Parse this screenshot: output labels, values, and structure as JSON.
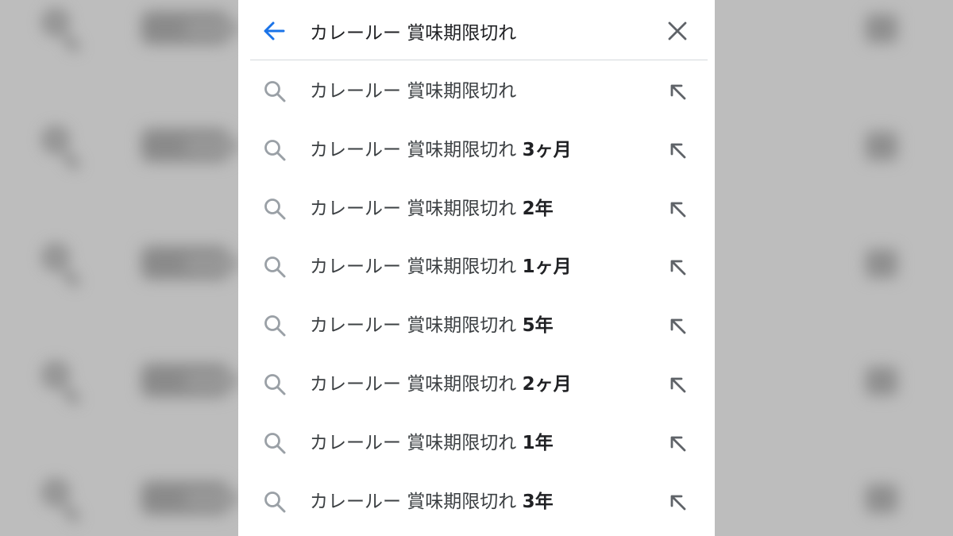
{
  "search": {
    "query": "カレールー 賞味期限切れ",
    "back_icon": "arrow-left-icon",
    "clear_icon": "close-icon"
  },
  "colors": {
    "accent": "#1a73e8",
    "icon_gray": "#9aa0a6",
    "text": "#202124"
  },
  "suggestions": [
    {
      "prefix": "カレールー 賞味期限切れ",
      "suffix": ""
    },
    {
      "prefix": "カレールー 賞味期限切れ",
      "suffix": "3ヶ月"
    },
    {
      "prefix": "カレールー 賞味期限切れ",
      "suffix": "2年"
    },
    {
      "prefix": "カレールー 賞味期限切れ",
      "suffix": "1ヶ月"
    },
    {
      "prefix": "カレールー 賞味期限切れ",
      "suffix": "5年"
    },
    {
      "prefix": "カレールー 賞味期限切れ",
      "suffix": "2ヶ月"
    },
    {
      "prefix": "カレールー 賞味期限切れ",
      "suffix": "1年"
    },
    {
      "prefix": "カレールー 賞味期限切れ",
      "suffix": "3年"
    }
  ]
}
